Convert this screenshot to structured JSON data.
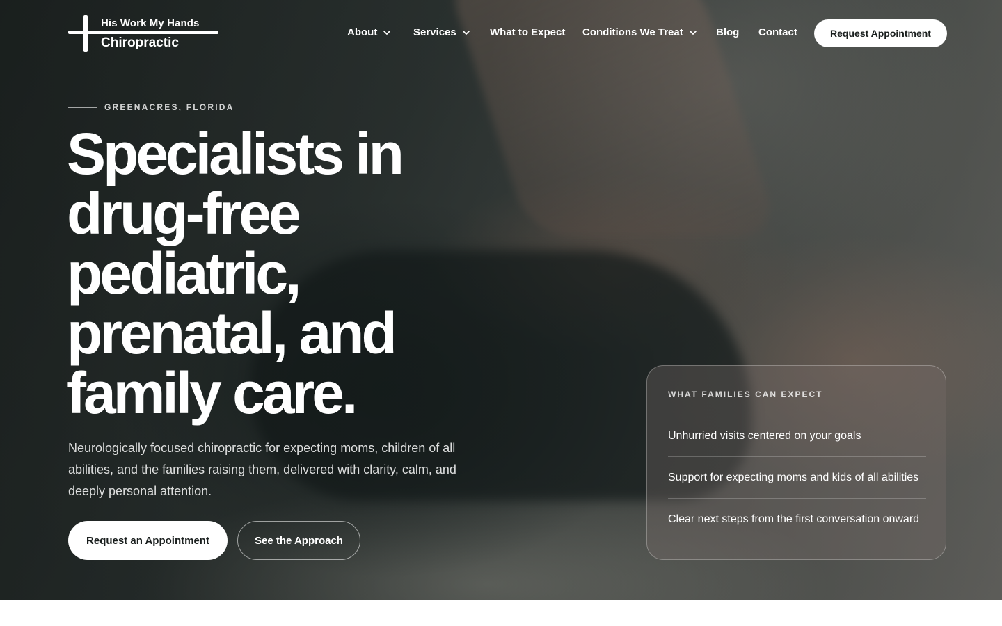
{
  "brand": {
    "line1": "His Work My Hands",
    "line2": "Chiropractic"
  },
  "nav": {
    "items": [
      {
        "label": "About",
        "has_dropdown": true
      },
      {
        "label": "Services",
        "has_dropdown": true
      },
      {
        "label": "What to Expect",
        "has_dropdown": false
      },
      {
        "label": "Conditions We Treat",
        "has_dropdown": true
      },
      {
        "label": "Blog",
        "has_dropdown": false
      },
      {
        "label": "Contact",
        "has_dropdown": false
      }
    ],
    "cta_label": "Request Appointment"
  },
  "hero": {
    "eyebrow": "GREENACRES, FLORIDA",
    "headline_lines": [
      "Specialists in",
      "drug-free",
      "pediatric,",
      "prenatal, and",
      "family care."
    ],
    "subtext": "Neurologically focused chiropractic for expecting moms, children of all abilities, and the families raising them, delivered with clarity, calm, and deeply personal attention.",
    "primary_button": "Request an Appointment",
    "secondary_button": "See the Approach"
  },
  "expect_card": {
    "title": "WHAT FAMILIES CAN EXPECT",
    "items": [
      "Unhurried visits centered on your goals",
      "Support for expecting moms and kids of all abilities",
      "Clear next steps from the first conversation onward"
    ]
  },
  "icons": {
    "dropdown": "chevron-down-icon",
    "logo": "cross-logo-icon"
  },
  "colors": {
    "button_bg": "#ffffff",
    "button_text": "#1a1f1e",
    "hero_dark": "#2d3432"
  }
}
